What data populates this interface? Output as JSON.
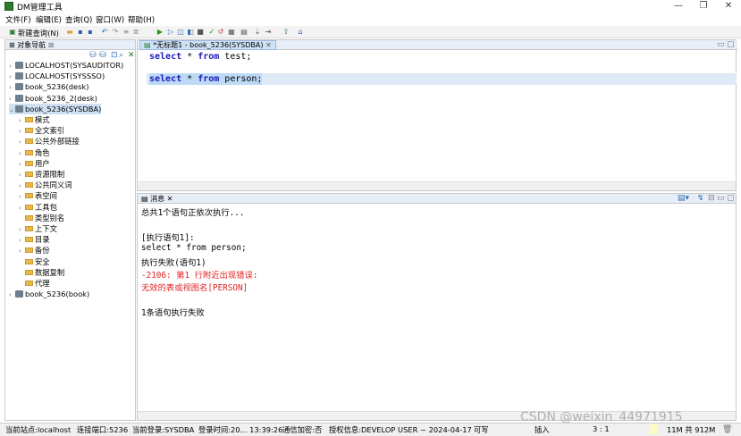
{
  "window": {
    "title": "DM管理工具",
    "minimize": "—",
    "maximize": "❐",
    "close": "✕"
  },
  "menu": [
    "文件(F)",
    "编辑(E)",
    "查询(Q)",
    "窗口(W)",
    "帮助(H)"
  ],
  "toolbar": {
    "new_query": "新建查询(N)"
  },
  "nav": {
    "title": "对象导航",
    "items": [
      {
        "label": "LOCALHOST(SYSAUDITOR)",
        "level": 0
      },
      {
        "label": "LOCALHOST(SYSSSO)",
        "level": 0
      },
      {
        "label": "book_5236(desk)",
        "level": 0
      },
      {
        "label": "book_5236_2(desk)",
        "level": 0
      },
      {
        "label": "book_5236(SYSDBA)",
        "level": 0
      },
      {
        "label": "模式",
        "level": 1
      },
      {
        "label": "全文索引",
        "level": 1
      },
      {
        "label": "公共外部链接",
        "level": 1
      },
      {
        "label": "角色",
        "level": 1
      },
      {
        "label": "用户",
        "level": 1
      },
      {
        "label": "资源限制",
        "level": 1
      },
      {
        "label": "公共同义词",
        "level": 1
      },
      {
        "label": "表空间",
        "level": 1
      },
      {
        "label": "工具包",
        "level": 1
      },
      {
        "label": "类型别名",
        "level": 1
      },
      {
        "label": "上下文",
        "level": 1
      },
      {
        "label": "目录",
        "level": 1
      },
      {
        "label": "备份",
        "level": 1
      },
      {
        "label": "安全",
        "level": 1
      },
      {
        "label": "数据复制",
        "level": 1
      },
      {
        "label": "代理",
        "level": 1
      },
      {
        "label": "book_5236(book)",
        "level": 0
      }
    ]
  },
  "editor": {
    "tab_label": "*无标题1 - book_5236(SYSDBA)",
    "line1": {
      "kw1": "select",
      "mid1": " * ",
      "kw2": "from",
      "rest": " test;"
    },
    "line2": {
      "kw1": "select",
      "mid1": " * ",
      "kw2": "from",
      "rest": " person;"
    }
  },
  "messages": {
    "tab_label": "消息",
    "lines": [
      {
        "text": "总共1个语句正依次执行...",
        "color": "#000000"
      },
      {
        "text": "",
        "color": "#000000"
      },
      {
        "text": "[执行语句1]:",
        "color": "#000000"
      },
      {
        "text": "select * from person;",
        "color": "#000000"
      },
      {
        "text": "执行失败(语句1)",
        "color": "#000000"
      },
      {
        "text": "-2106: 第1 行附近出现错误:",
        "color": "#e02020"
      },
      {
        "text": "无效的表或视图名[PERSON]",
        "color": "#e02020"
      },
      {
        "text": "",
        "color": "#000000"
      },
      {
        "text": "1条语句执行失败",
        "color": "#000000"
      }
    ]
  },
  "status": {
    "site": "当前站点:localhost",
    "port": "连接端口:5236",
    "login": "当前登录:SYSDBA",
    "login_time": "登录时间:20... 13:39:26",
    "encrypt": "通信加密:否",
    "license": "授权信息:DEVELOP USER ~ 2024-04-17",
    "writable": "可写",
    "insert": "插入",
    "cursor": "3 : 1",
    "memory": "11M 共 912M"
  },
  "watermark": "CSDN @weixin_44971915",
  "colors": {
    "keyword": "#1a1ab8",
    "selection": "#bcd9f5",
    "error": "#e02020"
  }
}
